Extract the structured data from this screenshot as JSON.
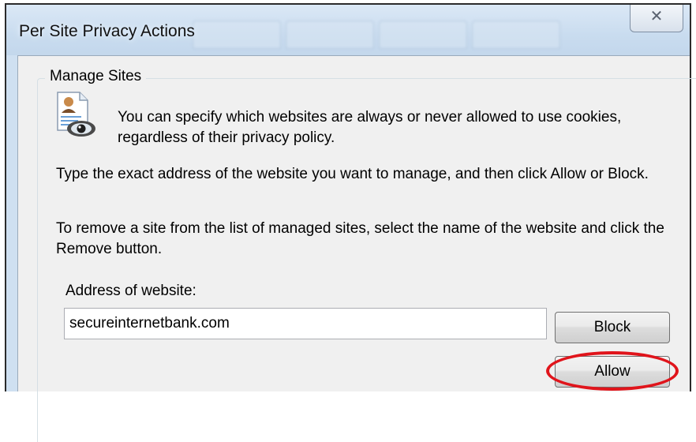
{
  "window": {
    "title": "Per Site Privacy Actions",
    "close_glyph": "✕"
  },
  "group": {
    "label": "Manage Sites",
    "intro": "You can specify which websites are always or never allowed to use cookies, regardless of their privacy policy.",
    "instructions": "Type the exact address of the website you want to manage, and then click Allow or Block.",
    "remove_note": "To remove a site from the list of managed sites, select the name of the website and click the Remove button."
  },
  "form": {
    "address_label": "Address of website:",
    "address_value": "secureinternetbank.com",
    "block_label": "Block",
    "allow_label": "Allow"
  },
  "colors": {
    "highlight": "#e0141b"
  },
  "icons": {
    "privacy_icon": "privacy-eye-document-icon"
  }
}
